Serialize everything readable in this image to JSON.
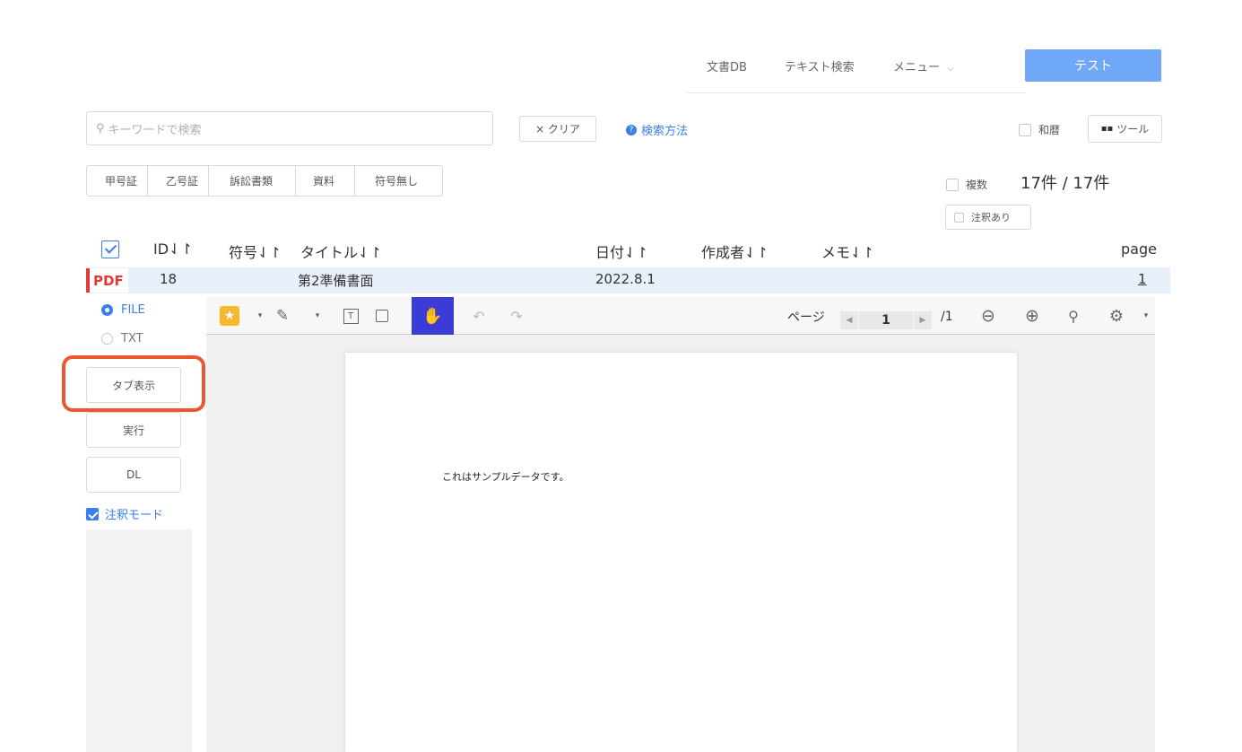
{
  "nav": {
    "items": [
      "文書DB",
      "テキスト検索",
      "メニュー"
    ],
    "button": "テスト"
  },
  "search": {
    "placeholder": "キーワードで検索",
    "clear_label": "× クリア",
    "help_label": "検索方法",
    "wareki_label": "和暦",
    "tools_label": "ツール"
  },
  "categories": [
    "甲号証",
    "乙号証",
    "訴訟書類",
    "資料",
    "符号無し"
  ],
  "filters": {
    "multiple_label": "複数",
    "count_text": "17件 / 17件",
    "annotated_label": "注釈あり"
  },
  "table": {
    "headers": {
      "id": "ID⇃↾",
      "code": "符号⇃↾",
      "title": "タイトル⇃↾",
      "date": "日付⇃↾",
      "author": "作成者⇃↾",
      "memo": "メモ⇃↾",
      "page": "page"
    },
    "rows": [
      {
        "type": "PDF",
        "id": "18",
        "code": "",
        "title": "第2準備書面",
        "date": "2022.8.1",
        "author": "",
        "memo": "",
        "page": "1"
      }
    ]
  },
  "side": {
    "file_label": "FILE",
    "txt_label": "TXT",
    "tab_view": "タブ表示",
    "execute": "実行",
    "download": "DL",
    "annotation_mode": "注釈モード"
  },
  "viewer": {
    "page_label": "ページ",
    "current_page": "1",
    "total_pages": "/1",
    "content_text": "これはサンプルデータです。"
  },
  "colors": {
    "accent": "#3a7ee8",
    "primary_button": "#6fa8f7",
    "pdf_red": "#e03a3a",
    "highlight": "#ee5533",
    "row_selected": "#e8f0fc",
    "hand_tool_active": "#3b3bd6",
    "star": "#f5b82e"
  }
}
